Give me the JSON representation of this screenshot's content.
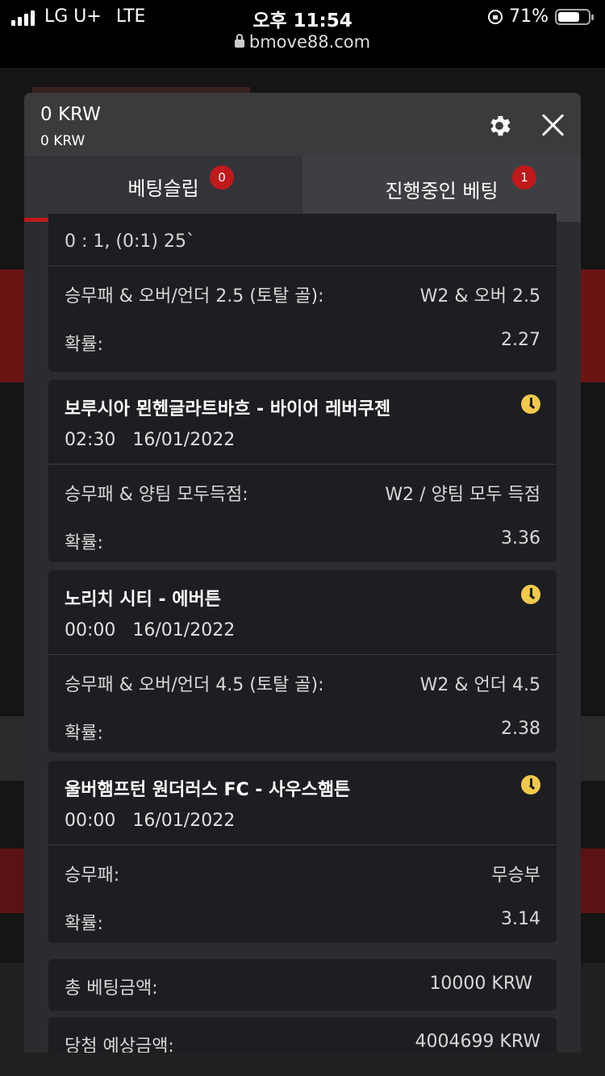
{
  "status": {
    "carrier": "LG U+",
    "network": "LTE",
    "time": "오후 11:54",
    "battery": "71%",
    "battery_level": 0.71,
    "url": "bmove88.com"
  },
  "modal": {
    "balance_primary": "0 KRW",
    "balance_secondary": "0 KRW",
    "tabs": [
      {
        "label": "베팅슬립",
        "badge": "0"
      },
      {
        "label": "진행중인 베팅",
        "badge": "1"
      }
    ]
  },
  "bets": [
    {
      "title": "",
      "date_line": "0 : 1, (0:1) 25`",
      "market": "승무패 & 오버/언더 2.5 (토탈 골):",
      "selection": "W2 & 오버 2.5",
      "odds_label": "확률:",
      "odds": "2.27"
    },
    {
      "title": "보루시아 묀헨글라트바흐 - 바이어 레버쿠젠",
      "time": "02:30",
      "date": "16/01/2022",
      "market": "승무패 & 양팀 모두득점:",
      "selection": "W2 / 양팀 모두 득점",
      "odds_label": "확률:",
      "odds": "3.36"
    },
    {
      "title": "노리치 시티 - 에버튼",
      "time": "00:00",
      "date": "16/01/2022",
      "market": "승무패 & 오버/언더 4.5 (토탈 골):",
      "selection": "W2 & 언더 4.5",
      "odds_label": "확률:",
      "odds": "2.38"
    },
    {
      "title": "울버햄프턴 원더러스 FC - 사우스햄튼",
      "time": "00:00",
      "date": "16/01/2022",
      "market": "승무패:",
      "selection": "무승부",
      "odds_label": "확률:",
      "odds": "3.14"
    }
  ],
  "summary": {
    "total_label": "총 베팅금액:",
    "total_value": "10000 KRW",
    "win_label": "당첨 예상금액:",
    "win_value": "4004699 KRW"
  }
}
